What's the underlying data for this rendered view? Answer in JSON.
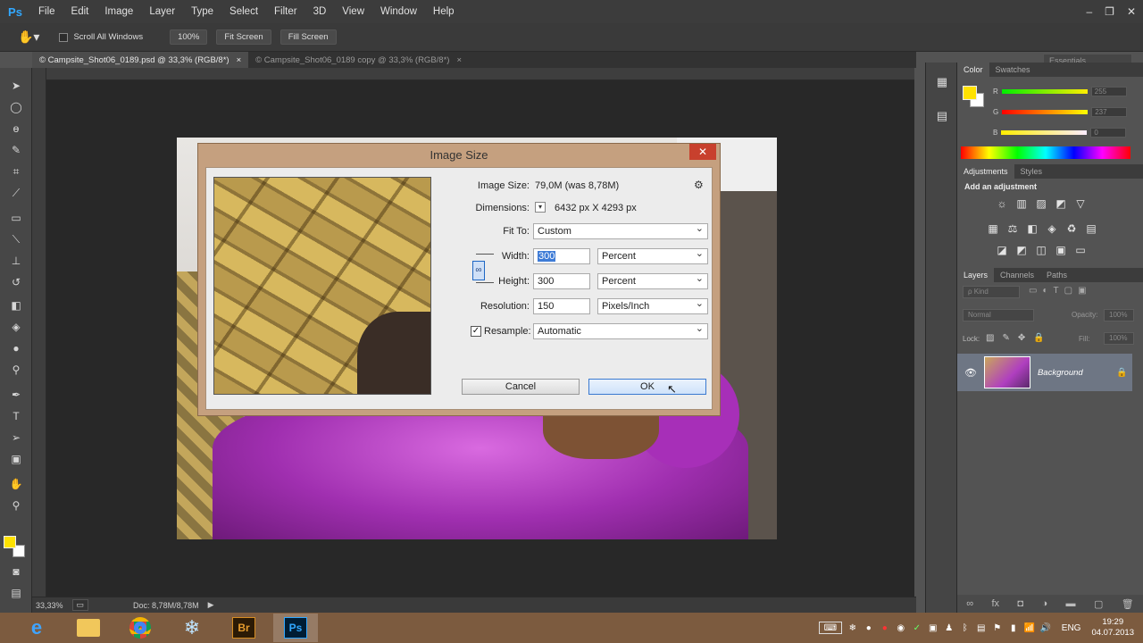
{
  "app": {
    "logo": "Ps"
  },
  "menu": [
    "File",
    "Edit",
    "Image",
    "Layer",
    "Type",
    "Select",
    "Filter",
    "3D",
    "View",
    "Window",
    "Help"
  ],
  "window_controls": [
    "–",
    "❐",
    "✕"
  ],
  "options": {
    "scroll_all": "Scroll All Windows",
    "zoom_100": "100%",
    "fit_screen": "Fit Screen",
    "fill_screen": "Fill Screen",
    "workspace": "Essentials"
  },
  "tabs": [
    {
      "label": "© Campsite_Shot06_0189.psd @ 33,3% (RGB/8*)",
      "close": "×"
    },
    {
      "label": "© Campsite_Shot06_0189 copy @ 33,3% (RGB/8*)",
      "close": "×"
    }
  ],
  "status": {
    "zoom": "33,33%",
    "doc": "Doc: 8,78M/8,78M"
  },
  "panels": {
    "color_tabs": [
      "Color",
      "Swatches"
    ],
    "color_channels": [
      {
        "label": "R",
        "value": "255"
      },
      {
        "label": "G",
        "value": "237"
      },
      {
        "label": "B",
        "value": "0"
      }
    ],
    "adj_tabs": [
      "Adjustments",
      "Styles"
    ],
    "adj_title": "Add an adjustment",
    "layer_tabs": [
      "Layers",
      "Channels",
      "Paths"
    ],
    "kind": "ρ Kind",
    "blend": "Normal",
    "opacity_label": "Opacity:",
    "opacity": "100%",
    "lock_label": "Lock:",
    "fill_label": "Fill:",
    "fill": "100%",
    "layer_name": "Background"
  },
  "dialog": {
    "title": "Image Size",
    "close": "✕",
    "image_size_label": "Image Size:",
    "image_size_value": "79,0M (was 8,78M)",
    "dimensions_label": "Dimensions:",
    "dimensions_value": "6432 px  X  4293 px",
    "fit_to_label": "Fit To:",
    "fit_to_value": "Custom",
    "width_label": "Width:",
    "width_value": "300",
    "width_unit": "Percent",
    "height_label": "Height:",
    "height_value": "300",
    "height_unit": "Percent",
    "resolution_label": "Resolution:",
    "resolution_value": "150",
    "resolution_unit": "Pixels/Inch",
    "resample_label": "Resample:",
    "resample_value": "Automatic",
    "cancel": "Cancel",
    "ok": "OK"
  },
  "taskbar": {
    "lang": "ENG",
    "time": "19:29",
    "date": "04.07.2013",
    "br": "Br",
    "ps": "Ps"
  }
}
